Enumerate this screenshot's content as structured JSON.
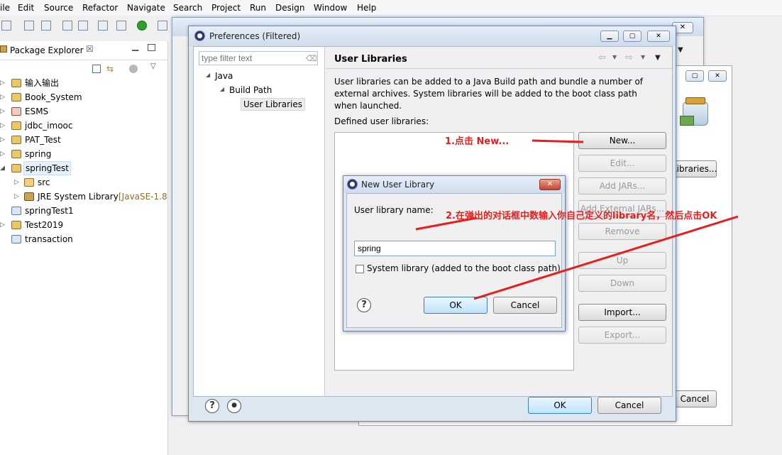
{
  "menubar": {
    "items": [
      "ile",
      "Edit",
      "Source",
      "Refactor",
      "Navigate",
      "Search",
      "Project",
      "Run",
      "Design",
      "Window",
      "Help"
    ]
  },
  "package_explorer": {
    "title": "Package Explorer",
    "tab_close": "☒",
    "tree": [
      {
        "label": "输入输出"
      },
      {
        "label": "Book_System"
      },
      {
        "label": "ESMS"
      },
      {
        "label": "jdbc_imooc"
      },
      {
        "label": "PAT_Test"
      },
      {
        "label": "spring"
      },
      {
        "label": "springTest"
      },
      {
        "label": "src"
      },
      {
        "label": "JRE System Library",
        "suffix": "[JavaSE-1.8"
      },
      {
        "label": "springTest1"
      },
      {
        "label": "Test2019"
      },
      {
        "label": "transaction"
      }
    ]
  },
  "background": {
    "libraries_button": "Libraries...",
    "cancel_button": "Cancel"
  },
  "preferences": {
    "title": "Preferences (Filtered)",
    "filter_placeholder": "type filter text",
    "tree": {
      "java": "Java",
      "build_path": "Build Path",
      "user_libraries": "User Libraries"
    },
    "page_title": "User Libraries",
    "description": "User libraries can be added to a Java Build path and bundle a number of external archives. System libraries will be added to the boot class path when launched.",
    "defined_label": "Defined user libraries:",
    "buttons": {
      "new": "New...",
      "edit": "Edit...",
      "add_jars": "Add JARs...",
      "add_external_jars": "Add External JARs...",
      "remove": "Remove",
      "up": "Up",
      "down": "Down",
      "import": "Import...",
      "export": "Export..."
    },
    "ok": "OK",
    "cancel": "Cancel"
  },
  "new_user_library": {
    "title": "New User Library",
    "name_label": "User library name:",
    "name_value": "spring",
    "system_library_label": "System library (added to the boot class path)",
    "system_library_checked": false,
    "ok": "OK",
    "cancel": "Cancel"
  },
  "annotations": {
    "step1": "1.点击 New...",
    "step2": "2.在弹出的对话框中数输入你自己定义的library名，然后点击OK"
  },
  "colors": {
    "annotation": "#e61e1e",
    "default_button": "#bfe3f9"
  }
}
